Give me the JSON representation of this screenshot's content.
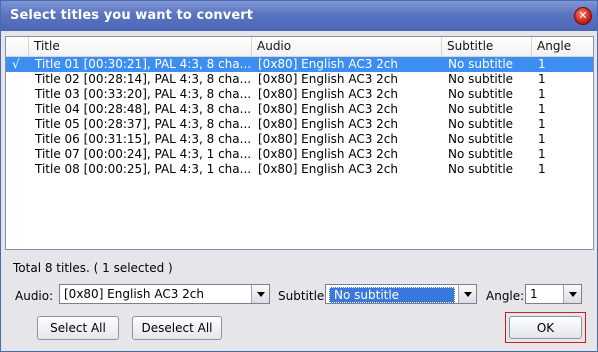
{
  "window": {
    "title": "Select titles you want to convert"
  },
  "table": {
    "columns": [
      "Title",
      "Audio",
      "Subtitle",
      "Angle"
    ],
    "rows": [
      {
        "check": "√",
        "title": "Title 01 [00:30:21], PAL 4:3, 8 cha...",
        "audio": "[0x80] English AC3 2ch",
        "subtitle": "No subtitle",
        "angle": "1",
        "selected": true
      },
      {
        "check": "",
        "title": "Title 02 [00:28:14], PAL 4:3, 8 cha...",
        "audio": "[0x80] English AC3 2ch",
        "subtitle": "No subtitle",
        "angle": "1",
        "selected": false
      },
      {
        "check": "",
        "title": "Title 03 [00:33:20], PAL 4:3, 8 cha...",
        "audio": "[0x80] English AC3 2ch",
        "subtitle": "No subtitle",
        "angle": "1",
        "selected": false
      },
      {
        "check": "",
        "title": "Title 04 [00:28:48], PAL 4:3, 8 cha...",
        "audio": "[0x80] English AC3 2ch",
        "subtitle": "No subtitle",
        "angle": "1",
        "selected": false
      },
      {
        "check": "",
        "title": "Title 05 [00:28:37], PAL 4:3, 8 cha...",
        "audio": "[0x80] English AC3 2ch",
        "subtitle": "No subtitle",
        "angle": "1",
        "selected": false
      },
      {
        "check": "",
        "title": "Title 06 [00:31:15], PAL 4:3, 8 cha...",
        "audio": "[0x80] English AC3 2ch",
        "subtitle": "No subtitle",
        "angle": "1",
        "selected": false
      },
      {
        "check": "",
        "title": "Title 07 [00:00:24], PAL 4:3, 1 cha...",
        "audio": "[0x80] English AC3 2ch",
        "subtitle": "No subtitle",
        "angle": "1",
        "selected": false
      },
      {
        "check": "",
        "title": "Title 08 [00:00:25], PAL 4:3, 1 cha...",
        "audio": "[0x80] English AC3 2ch",
        "subtitle": "No subtitle",
        "angle": "1",
        "selected": false
      }
    ]
  },
  "status": {
    "text": "Total 8 titles. ( 1 selected )"
  },
  "controls": {
    "audio_label": "Audio:",
    "audio_value": "[0x80] English AC3 2ch",
    "subtitle_label": "Subtitle:",
    "subtitle_value": "No subtitle",
    "angle_label": "Angle:",
    "angle_value": "1"
  },
  "buttons": {
    "select_all": "Select All",
    "deselect_all": "Deselect All",
    "ok": "OK"
  },
  "colors": {
    "titlebar": "#5b74c0",
    "selection": "#3c8ef0",
    "ok_border": "#c81e1e"
  },
  "icons": {
    "close": "close-icon",
    "dropdown": "chevron-down-icon"
  }
}
